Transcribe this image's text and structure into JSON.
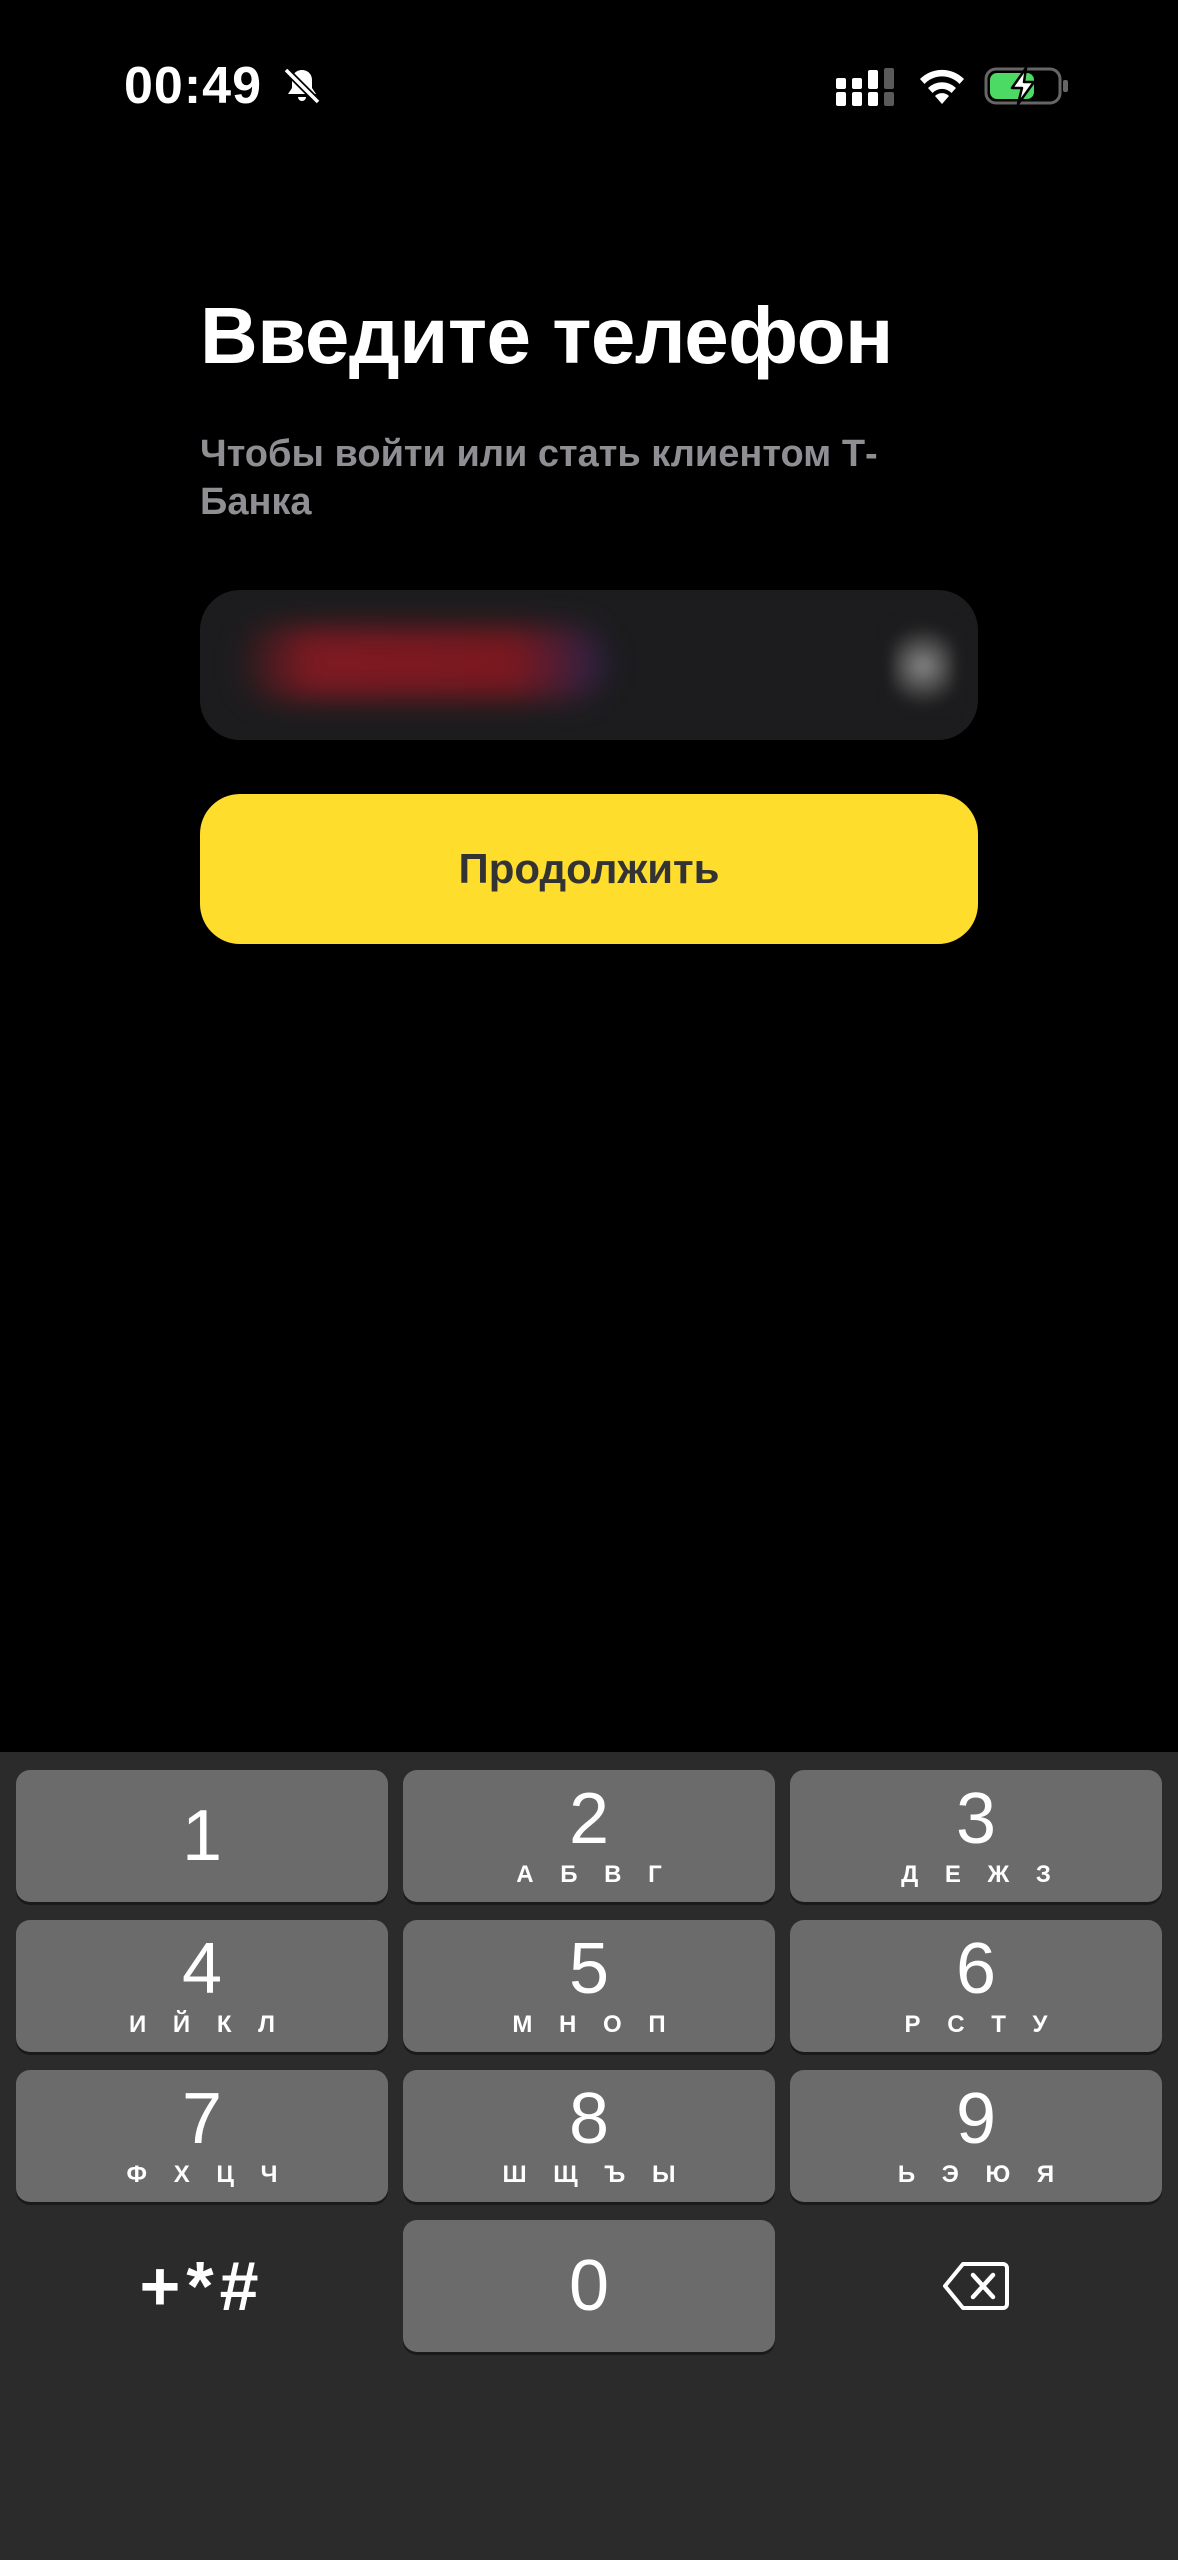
{
  "status_bar": {
    "time": "00:49",
    "icons": [
      "bell-muted-icon",
      "cellular-signal-icon",
      "wifi-icon",
      "battery-charging-icon"
    ],
    "battery_color": "#4cd964"
  },
  "auth": {
    "title": "Введите телефон",
    "subtitle": "Чтобы войти или стать клиентом Т-Банка",
    "phone_value": "",
    "continue_label": "Продолжить",
    "accent_color": "#ffdd2d"
  },
  "keyboard": {
    "keys": [
      {
        "digit": "1",
        "letters": ""
      },
      {
        "digit": "2",
        "letters": "А Б В Г"
      },
      {
        "digit": "3",
        "letters": "Д Е Ж З"
      },
      {
        "digit": "4",
        "letters": "И Й К Л"
      },
      {
        "digit": "5",
        "letters": "М Н О П"
      },
      {
        "digit": "6",
        "letters": "Р С Т У"
      },
      {
        "digit": "7",
        "letters": "Ф Х Ц Ч"
      },
      {
        "digit": "8",
        "letters": "Ш Щ Ъ Ы"
      },
      {
        "digit": "9",
        "letters": "Ь Э Ю Я"
      },
      {
        "digit": "0",
        "letters": ""
      }
    ],
    "symbols_label": "+*#",
    "delete_icon": "backspace-icon"
  }
}
